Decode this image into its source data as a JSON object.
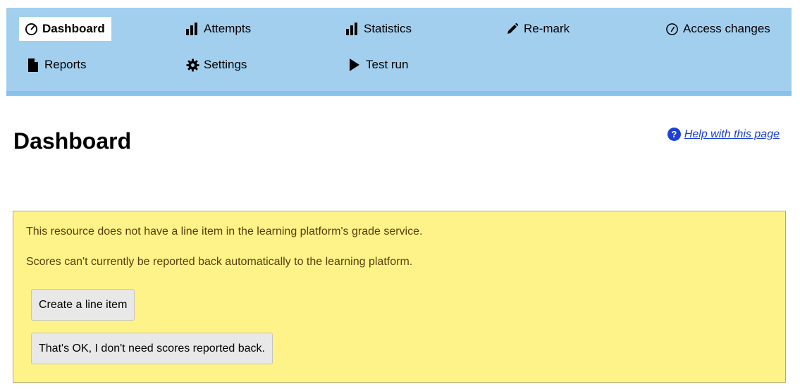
{
  "nav": {
    "items": [
      {
        "label": "Dashboard",
        "icon": "gauge-icon",
        "active": true
      },
      {
        "label": "Attempts",
        "icon": "bar-chart-icon"
      },
      {
        "label": "Statistics",
        "icon": "bar-chart-icon"
      },
      {
        "label": "Re-mark",
        "icon": "pencil-icon"
      },
      {
        "label": "Access changes",
        "icon": "gauge-icon"
      },
      {
        "label": "Reports",
        "icon": "document-icon"
      },
      {
        "label": "Settings",
        "icon": "gear-icon"
      },
      {
        "label": "Test run",
        "icon": "play-icon"
      }
    ]
  },
  "heading": {
    "title": "Dashboard",
    "help_label": "Help with this page",
    "help_icon": "question-icon"
  },
  "notice": {
    "line1": "This resource does not have a line item in the learning platform's grade service.",
    "line2": "Scores can't currently be reported back automatically to the learning platform.",
    "create_button": "Create a line item",
    "dismiss_button": "That's OK, I don't need scores reported back."
  },
  "colors": {
    "nav_background": "#a3cfee",
    "notice_background": "#fef389",
    "notice_text": "#5a3c0a",
    "link": "#1a3fd6"
  }
}
